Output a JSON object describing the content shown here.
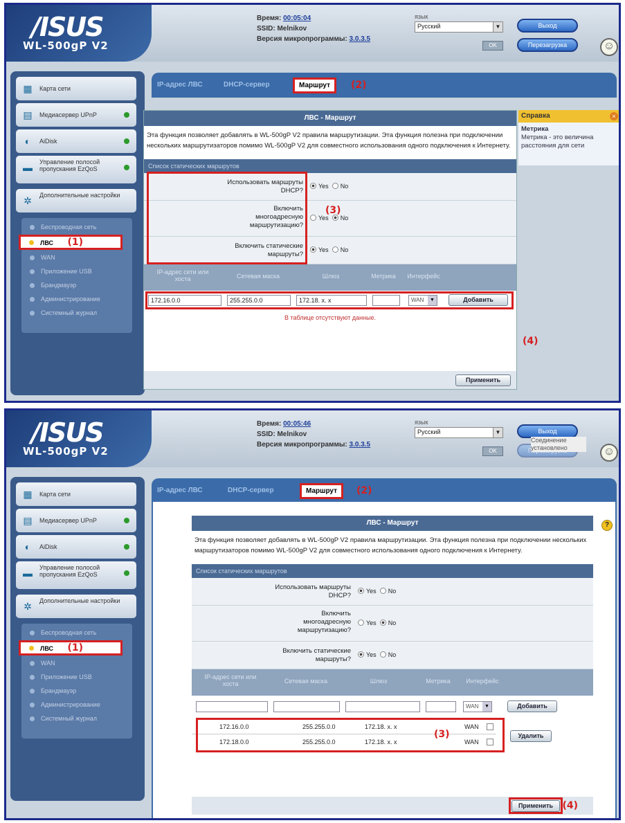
{
  "header": {
    "logo": "/ISUS",
    "model": "WL-500gP V2",
    "time_label": "Время:",
    "ssid_label": "SSID:",
    "ssid_value": "Melnikov",
    "fw_label": "Версия микропрограммы:",
    "fw_value": "3.0.3.5",
    "lang_label": "язык",
    "lang_value": "Русский",
    "ok_label": "OK",
    "logout_label": "Выход",
    "reboot_label": "Перезагрузка",
    "tooltip": "Соединение установлено"
  },
  "times": {
    "p1": "00:05:04",
    "p2": "00:05:46"
  },
  "sidebar": {
    "items": [
      {
        "label": "Карта сети",
        "icon": "network-map-icon"
      },
      {
        "label": "Медиасервер UPnP",
        "icon": "media-server-icon"
      },
      {
        "label": "AiDisk",
        "icon": "aidisk-icon"
      },
      {
        "label": "Управление полосой пропускания EzQoS",
        "icon": "qos-icon"
      },
      {
        "label": "Дополнительные настройки",
        "icon": "advanced-settings-icon"
      }
    ],
    "sub": [
      "Беспроводная сеть",
      "ЛВС",
      "WAN",
      "Приложение USB",
      "Брандмауэр",
      "Администрирование",
      "Системный журнал"
    ]
  },
  "tabs": [
    "IP-адрес ЛВС",
    "DHCP-сервер",
    "Маршрут"
  ],
  "annotations": [
    "(1)",
    "(2)",
    "(3)",
    "(4)"
  ],
  "content": {
    "title": "ЛВС - Маршрут",
    "desc": "Эта функция позволяет добавлять в WL-500gP V2 правила маршрутизации. Эта функция полезна при подключении нескольких маршрутизаторов помимо WL-500gP V2 для совместного использования одного подключения к Интернету.",
    "section": "Список статических маршрутов",
    "q1": "Использовать маршруты DHCP?",
    "q2": "Включить многоадресную маршрутизацию?",
    "q3": "Включить статические маршруты?",
    "yes": "Yes",
    "no": "No",
    "cols": [
      "IP-адрес сети или хоста",
      "Сетевая маска",
      "Шлюз",
      "Метрика",
      "Интерфейс"
    ],
    "input_ip": "172.16.0.0",
    "input_mask": "255.255.0.0",
    "input_gw": "172.18. x. x",
    "wan": "WAN",
    "add": "Добавить",
    "empty": "В таблице отсутствуют данные.",
    "apply": "Применить",
    "delete": "Удалить",
    "routes": [
      {
        "ip": "172.16.0.0",
        "mask": "255.255.0.0",
        "gw": "172.18. x. x",
        "iface": "WAN"
      },
      {
        "ip": "172.18.0.0",
        "mask": "255.255.0.0",
        "gw": "172.18. x. x",
        "iface": "WAN"
      }
    ]
  },
  "help": {
    "title": "Справка",
    "term": "Метрика",
    "text": "Метрика - это величина расстояния для сети"
  }
}
